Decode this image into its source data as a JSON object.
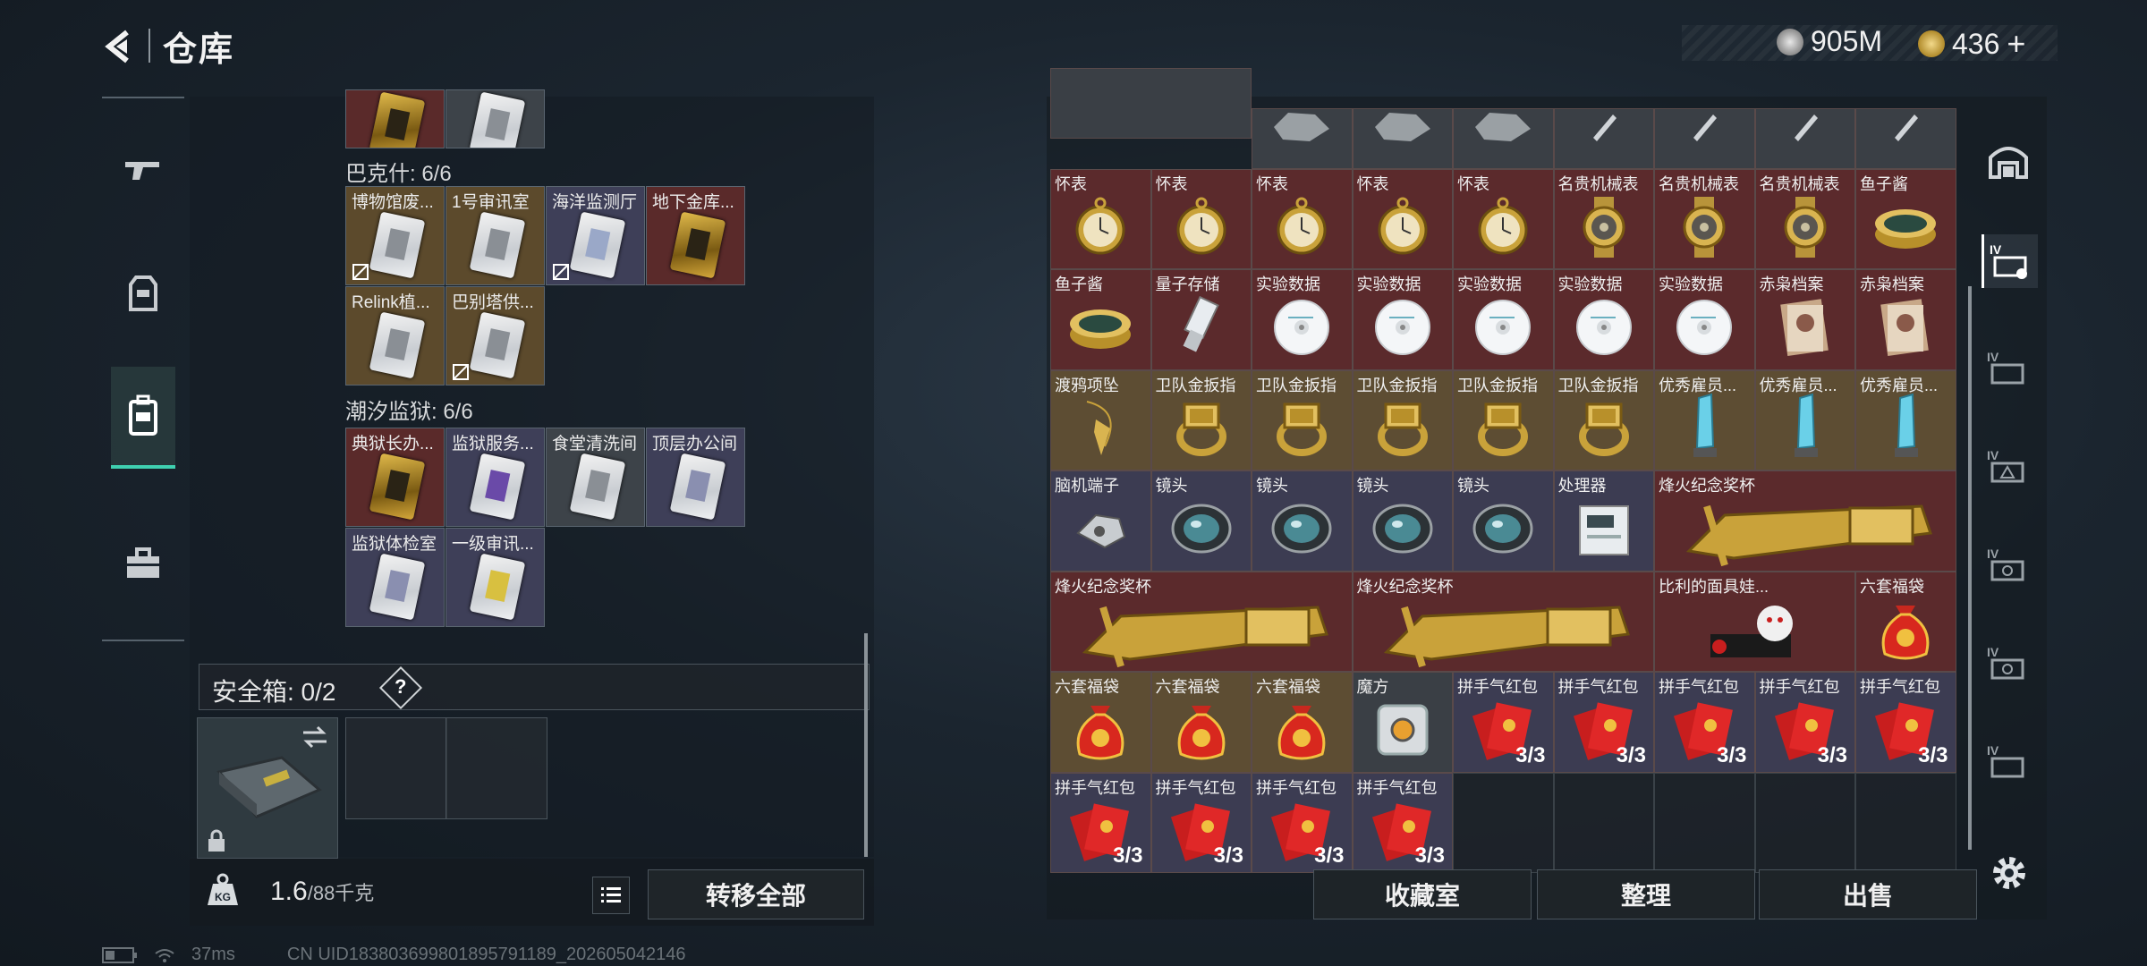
{
  "header": {
    "title": "仓库"
  },
  "currency": {
    "coins": "905M",
    "tickets": "436",
    "plus": "+"
  },
  "left": {
    "groups": [
      {
        "label": "巴克什: 6/6"
      },
      {
        "label": "潮汐监狱: 6/6"
      }
    ],
    "bakshi_items": [
      "博物馆废...",
      "1号审讯室",
      "海洋监测厅",
      "地下金库...",
      "Relink植...",
      "巴别塔供..."
    ],
    "prison_items": [
      "典狱长办...",
      "监狱服务...",
      "食堂清洗间",
      "顶层办公间",
      "监狱体检室",
      "一级审讯..."
    ],
    "safe_box": {
      "label": "安全箱: 0/2",
      "help": "?"
    },
    "weight": {
      "current": "1.6",
      "max": "/88千克"
    },
    "transfer_all": "转移全部",
    "status": {
      "ping": "37ms",
      "uid": "CN UID183803699801895791189_202605042146"
    }
  },
  "right": {
    "row1": [
      "怀表",
      "怀表",
      "怀表",
      "怀表",
      "怀表",
      "名贵机械表",
      "名贵机械表",
      "名贵机械表",
      "鱼子酱"
    ],
    "row2": [
      "鱼子酱",
      "量子存储",
      "实验数据",
      "实验数据",
      "实验数据",
      "实验数据",
      "实验数据",
      "赤枭档案",
      "赤枭档案"
    ],
    "row3": [
      "渡鸦项坠",
      "卫队金扳指",
      "卫队金扳指",
      "卫队金扳指",
      "卫队金扳指",
      "卫队金扳指",
      "优秀雇员...",
      "优秀雇员...",
      "优秀雇员..."
    ],
    "row4": [
      "脑机端子",
      "镜头",
      "镜头",
      "镜头",
      "镜头",
      "处理器",
      "烽火纪念奖杯"
    ],
    "row5": [
      "烽火纪念奖杯",
      "烽火纪念奖杯",
      "比利的面具娃...",
      "六套福袋"
    ],
    "row6": [
      "六套福袋",
      "六套福袋",
      "六套福袋",
      "魔方",
      "拼手气红包",
      "拼手气红包",
      "拼手气红包",
      "拼手气红包",
      "拼手气红包"
    ],
    "row7": [
      "拼手气红包",
      "拼手气红包",
      "拼手气红包",
      "拼手气红包"
    ],
    "red_count": "3/3",
    "buttons": {
      "collection": "收藏室",
      "sort": "整理",
      "sell": "出售"
    }
  },
  "colors": {
    "accent": "#3fd0b0",
    "red_slot": "#5b2a2c",
    "gold_slot": "#5d4d33"
  }
}
